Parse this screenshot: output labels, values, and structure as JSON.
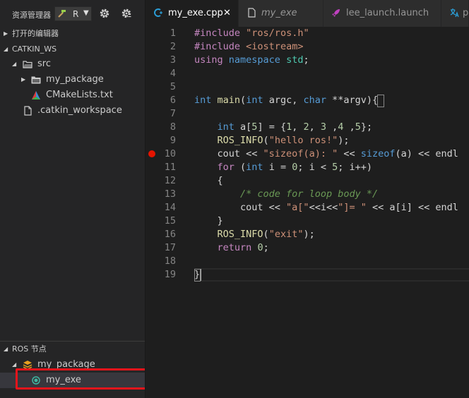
{
  "sidebar": {
    "title": "资源管理器",
    "tool_label": "R",
    "sections": {
      "open_editors": "打开的编辑器",
      "workspace": "CATKIN_WS",
      "ros_nodes": "ROS 节点"
    },
    "tree": [
      {
        "label": "src"
      },
      {
        "label": "my_package"
      },
      {
        "label": "CMakeLists.txt"
      },
      {
        "label": ".catkin_workspace"
      }
    ],
    "ros_tree": [
      {
        "label": "my_package"
      },
      {
        "label": "my_exe"
      }
    ]
  },
  "tabs": [
    {
      "label": "my_exe.cpp",
      "active": true
    },
    {
      "label": "my_exe",
      "active": false
    },
    {
      "label": "lee_launch.launch",
      "active": false
    },
    {
      "label": "p",
      "active": false
    }
  ],
  "editor": {
    "line_numbers": [
      "1",
      "2",
      "3",
      "4",
      "5",
      "6",
      "7",
      "8",
      "9",
      "10",
      "11",
      "12",
      "13",
      "14",
      "15",
      "16",
      "17",
      "18",
      "19"
    ],
    "breakpoint_line": "10",
    "lines": [
      "#include \"ros/ros.h\"",
      "#include <iostream>",
      "using namespace std;",
      "",
      "",
      "int main(int argc, char **argv){",
      "",
      "    int a[5] = {1, 2, 3 ,4 ,5};",
      "    ROS_INFO(\"hello ros!\");",
      "    cout << \"sizeof(a): \" << sizeof(a) << endl",
      "    for (int i = 0; i < 5; i++)",
      "    {",
      "        /* code for loop body */",
      "        cout << \"a[\"<<i<<\"]= \" << a[i] << endl",
      "    }",
      "    ROS_INFO(\"exit\");",
      "    return 0;",
      "",
      "}"
    ]
  },
  "colors": {
    "accent_highlight": "#e8141b",
    "breakpoint": "#e51400",
    "cpp_icon": "#2b9fd8",
    "launch_icon": "#c040c0"
  }
}
